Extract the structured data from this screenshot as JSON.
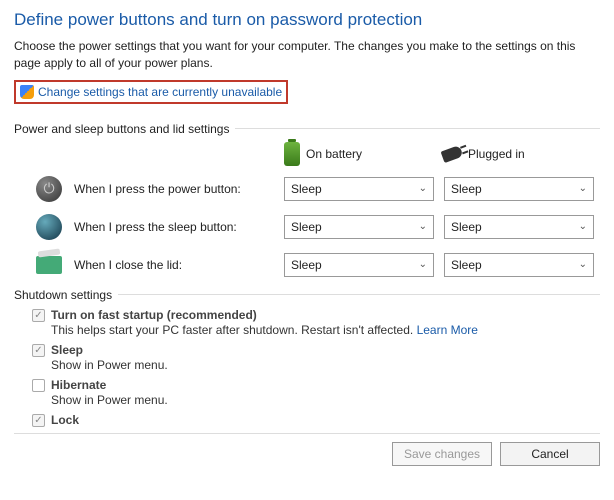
{
  "title": "Define power buttons and turn on password protection",
  "description": "Choose the power settings that you want for your computer. The changes you make to the settings on this page apply to all of your power plans.",
  "changeLink": "Change settings that are currently unavailable",
  "section1": "Power and sleep buttons and lid settings",
  "cols": {
    "battery": "On battery",
    "plugged": "Plugged in"
  },
  "rows": {
    "power": {
      "label": "When I press the power button:",
      "bat": "Sleep",
      "plug": "Sleep"
    },
    "sleep": {
      "label": "When I press the sleep button:",
      "bat": "Sleep",
      "plug": "Sleep"
    },
    "lid": {
      "label": "When I close the lid:",
      "bat": "Sleep",
      "plug": "Sleep"
    }
  },
  "section2": "Shutdown settings",
  "shutdown": {
    "fast": {
      "title": "Turn on fast startup (recommended)",
      "sub": "This helps start your PC faster after shutdown. Restart isn't affected. ",
      "learn": "Learn More"
    },
    "sleep": {
      "title": "Sleep",
      "sub": "Show in Power menu."
    },
    "hiber": {
      "title": "Hibernate",
      "sub": "Show in Power menu."
    },
    "lock": {
      "title": "Lock",
      "sub": ""
    }
  },
  "buttons": {
    "save": "Save changes",
    "cancel": "Cancel"
  }
}
